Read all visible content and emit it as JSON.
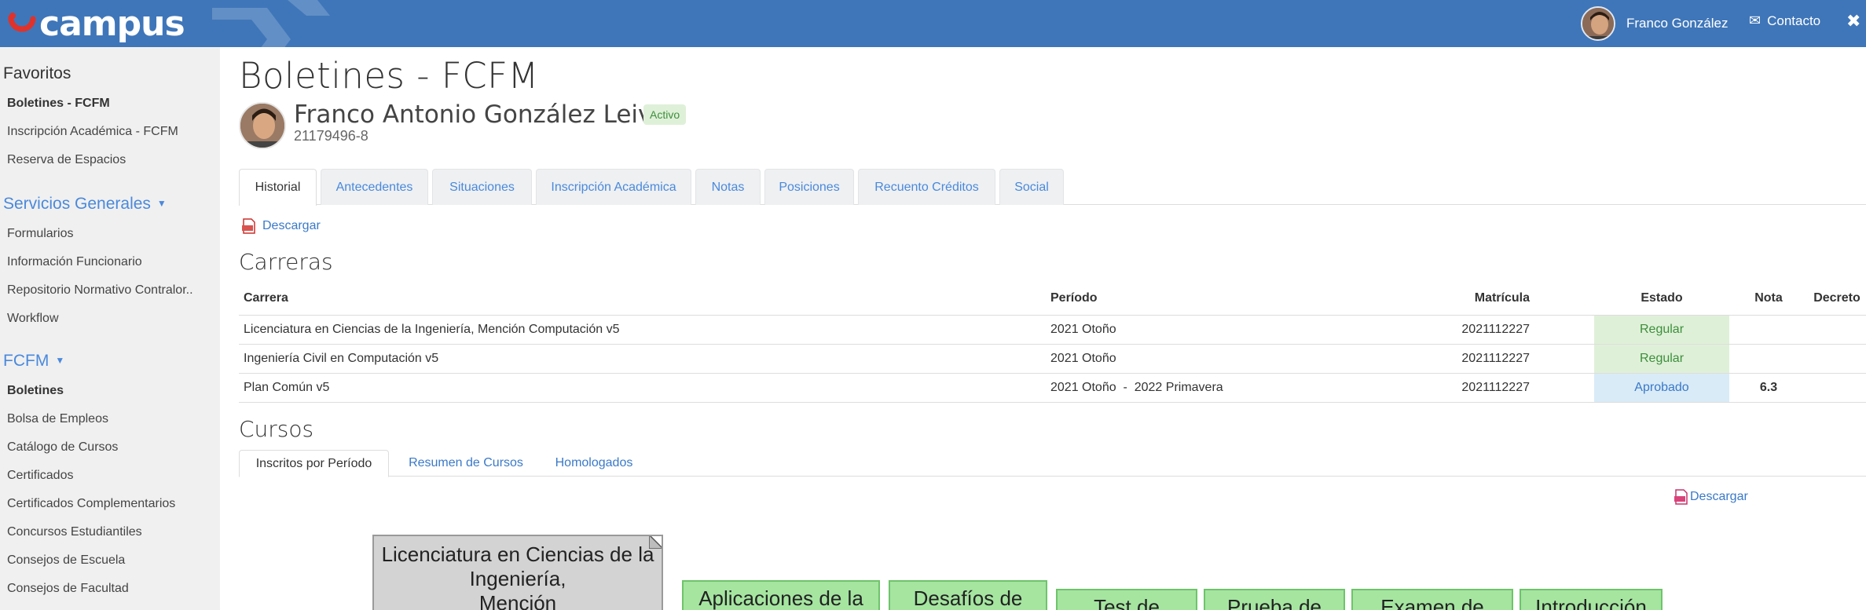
{
  "header": {
    "logo": "campus",
    "user_name": "Franco González",
    "contact_label": "Contacto",
    "close_glyph": "✖",
    "mail_glyph": "✉",
    "bg_color": "#3f76b9"
  },
  "sidebar": {
    "favoritos_title": "Favoritos",
    "favoritos": [
      "Boletines - FCFM",
      "Inscripción Académica - FCFM",
      "Reserva de Espacios"
    ],
    "servicios_title": "Servicios Generales",
    "servicios": [
      "Formularios",
      "Información Funcionario",
      "Repositorio Normativo Contralor..",
      "Workflow"
    ],
    "fcfm_title": "FCFM",
    "fcfm": [
      "Boletines",
      "Bolsa de Empleos",
      "Catálogo de Cursos",
      "Certificados",
      "Certificados Complementarios",
      "Concursos Estudiantiles",
      "Consejos de Escuela",
      "Consejos de Facultad"
    ],
    "caret": "▼"
  },
  "page": {
    "title": "Boletines - FCFM",
    "student_name": "Franco Antonio González Leiva",
    "status_badge": "Activo",
    "rut": "21179496-8"
  },
  "tabs": [
    "Historial",
    "Antecedentes",
    "Situaciones",
    "Inscripción Académica",
    "Notas",
    "Posiciones",
    "Recuento Créditos",
    "Social"
  ],
  "download_label": "Descargar",
  "carreras": {
    "title": "Carreras",
    "headers": [
      "Carrera",
      "Período",
      "Matrícula",
      "Estado",
      "Nota",
      "Decreto"
    ],
    "rows": [
      {
        "carrera": "Licenciatura en Ciencias de la Ingeniería, Mención Computación v5",
        "periodo": "2021 Otoño",
        "matricula": "2021112227",
        "estado": "Regular",
        "nota": "",
        "decreto": ""
      },
      {
        "carrera": "Ingeniería Civil en Computación v5",
        "periodo": "2021 Otoño",
        "matricula": "2021112227",
        "estado": "Regular",
        "nota": "",
        "decreto": ""
      },
      {
        "carrera": "Plan Común v5",
        "periodo": "2021 Otoño  -  2022 Primavera",
        "matricula": "2021112227",
        "estado": "Aprobado",
        "nota": "6.3",
        "decreto": ""
      }
    ]
  },
  "cursos": {
    "title": "Cursos",
    "subtabs": [
      "Inscritos por Período",
      "Resumen de Cursos",
      "Homologados"
    ],
    "download_label": "Descargar"
  },
  "diagram": {
    "main_node": [
      "Licenciatura en Ciencias de la",
      "Ingeniería,",
      "Mención"
    ],
    "nodes": [
      "Aplicaciones de la",
      "Desafíos de",
      "Test de",
      "Prueba de",
      "Examen de",
      "Introducción"
    ]
  }
}
